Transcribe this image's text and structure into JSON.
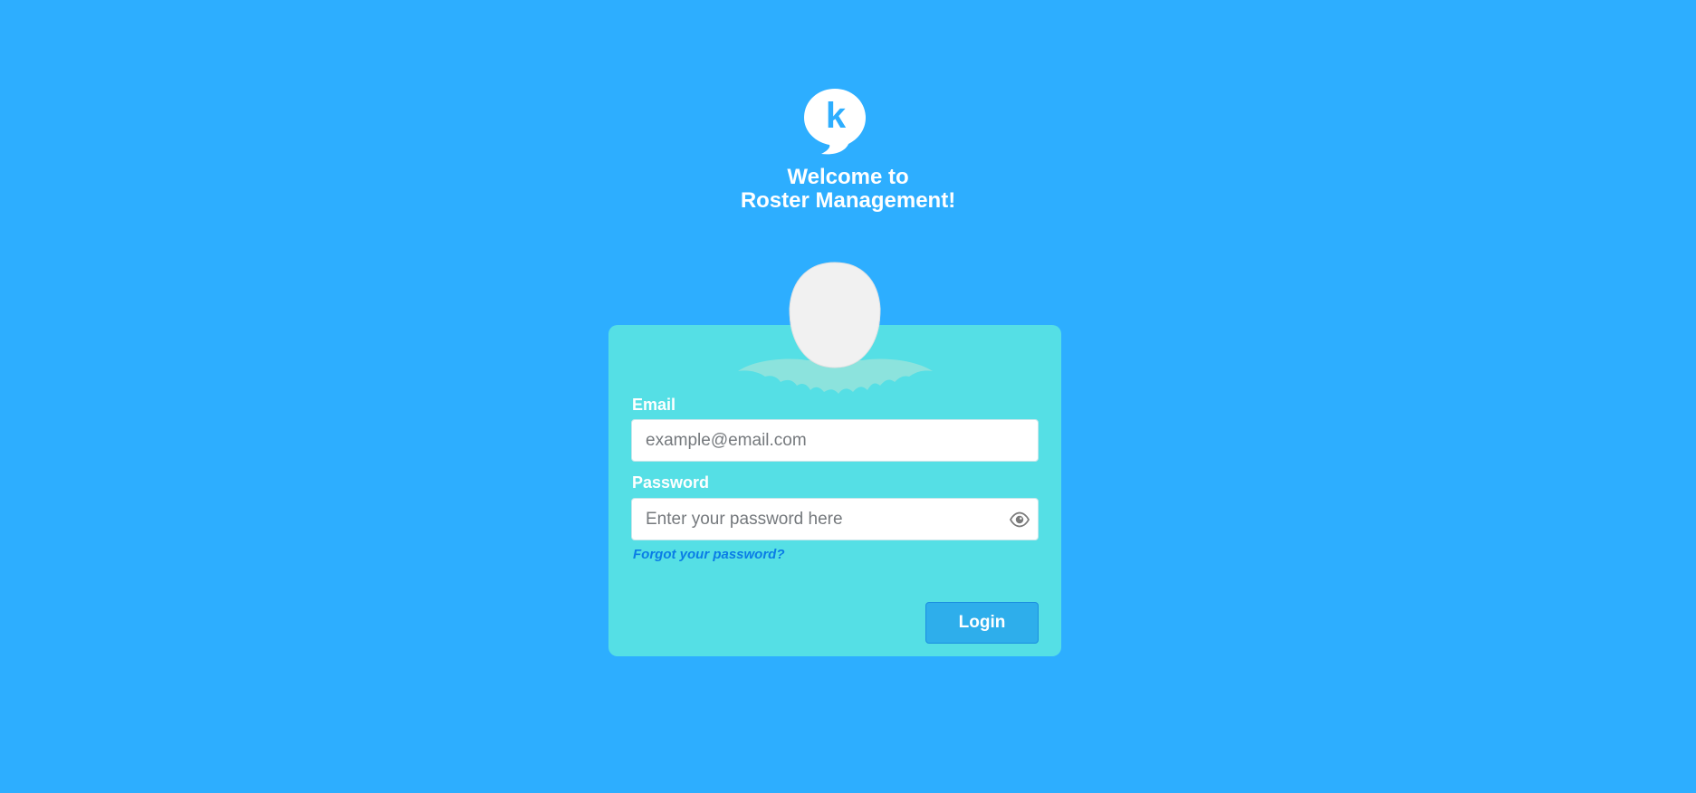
{
  "header": {
    "logo_icon": "speech-bubble-k-logo",
    "logo_letter": "k",
    "title_line1": "Welcome to",
    "title_line2": "Roster Management!"
  },
  "form": {
    "email_label": "Email",
    "email_placeholder": "example@email.com",
    "email_value": "",
    "password_label": "Password",
    "password_placeholder": "Enter your password here",
    "password_value": "",
    "password_toggle_icon": "eye-icon",
    "forgot_link": "Forgot your password?",
    "login_button": "Login"
  },
  "colors": {
    "background": "#2daeff",
    "card": "#55dfe5",
    "button": "#2eaeeb",
    "link": "#0a7de6",
    "egg": "#f1f1f1",
    "nest": "#8fe3dc"
  }
}
